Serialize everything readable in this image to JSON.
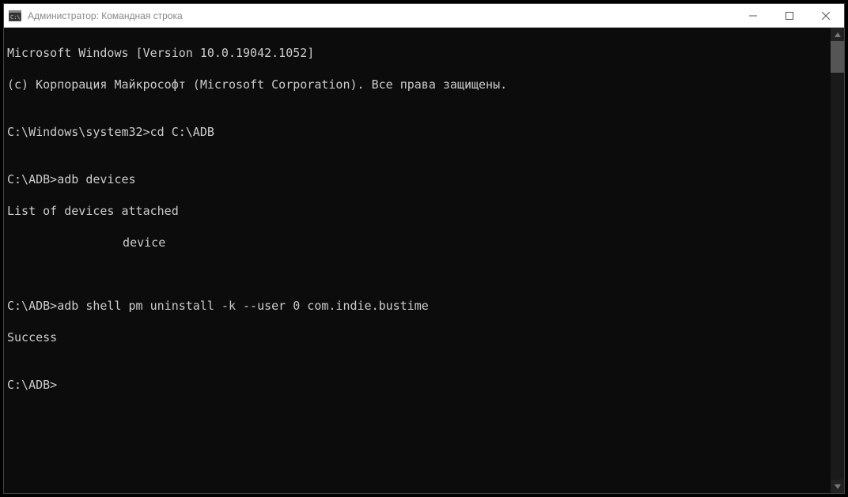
{
  "window": {
    "title": "Администратор: Командная строка"
  },
  "terminal": {
    "lines": [
      "Microsoft Windows [Version 10.0.19042.1052]",
      "(c) Корпорация Майкрософт (Microsoft Corporation). Все права защищены.",
      "",
      "C:\\Windows\\system32>cd C:\\ADB",
      "",
      "C:\\ADB>adb devices",
      "List of devices attached",
      "",
      "",
      "",
      "C:\\ADB>adb shell pm uninstall -k --user 0 com.indie.bustime",
      "Success",
      "",
      "C:\\ADB>"
    ],
    "device_line_suffix": "  device"
  }
}
